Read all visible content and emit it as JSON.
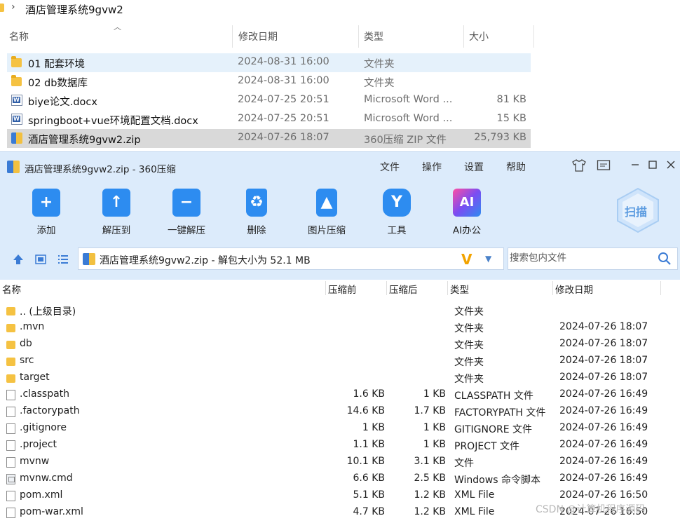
{
  "explorer": {
    "breadcrumb": "酒店管理系统9gvw2",
    "headers": {
      "name": "名称",
      "date": "修改日期",
      "type": "类型",
      "size": "大小"
    },
    "rows": [
      {
        "name": "01 配套环境",
        "date": "2024-08-31 16:00",
        "type": "文件夹",
        "size": "",
        "icon": "folder-icon",
        "state": "hover"
      },
      {
        "name": "02 db数据库",
        "date": "2024-08-31 16:00",
        "type": "文件夹",
        "size": "",
        "icon": "folder-icon",
        "state": ""
      },
      {
        "name": "biye论文.docx",
        "date": "2024-07-25 20:51",
        "type": "Microsoft Word ...",
        "size": "81 KB",
        "icon": "word-doc-icon",
        "state": ""
      },
      {
        "name": "springboot+vue环境配置文档.docx",
        "date": "2024-07-25 20:51",
        "type": "Microsoft Word ...",
        "size": "15 KB",
        "icon": "word-doc-icon",
        "state": ""
      },
      {
        "name": "酒店管理系统9gvw2.zip",
        "date": "2024-07-26 18:07",
        "type": "360压缩 ZIP 文件",
        "size": "25,793 KB",
        "icon": "zip-archive-icon",
        "state": "selected"
      }
    ]
  },
  "window": {
    "title": "酒店管理系统9gvw2.zip - 360压缩",
    "menu": [
      "文件",
      "操作",
      "设置",
      "帮助"
    ],
    "tools": [
      {
        "label": "添加",
        "icon": "add-folder-icon",
        "color": "#2d8cf0",
        "glyph": "+"
      },
      {
        "label": "解压到",
        "icon": "extract-to-icon",
        "color": "#2d8cf0",
        "glyph": "↑"
      },
      {
        "label": "一键解压",
        "icon": "one-click-extract-icon",
        "color": "#2d8cf0",
        "glyph": "−"
      },
      {
        "label": "删除",
        "icon": "recycle-bin-icon",
        "color": "#2d8cf0",
        "glyph": "♻"
      },
      {
        "label": "图片压缩",
        "icon": "image-compress-icon",
        "color": "#2d8cf0",
        "glyph": "▲"
      },
      {
        "label": "工具",
        "icon": "tools-icon",
        "color": "#2d8cf0",
        "glyph": "Y"
      },
      {
        "label": "AI办公",
        "icon": "ai-office-icon",
        "color": "#7b4df2",
        "glyph": "AI"
      }
    ],
    "scan_label": "扫描",
    "path": "酒店管理系统9gvw2.zip - 解包大小为 52.1 MB",
    "search_placeholder": "搜索包内文件",
    "columns": {
      "name": "名称",
      "compressed_before": "压缩前",
      "compressed_after": "压缩后",
      "type": "类型",
      "modified": "修改日期"
    },
    "files": [
      {
        "name": ".. (上级目录)",
        "before": "",
        "after": "",
        "type": "文件夹",
        "date": "",
        "icon": "folder"
      },
      {
        "name": ".mvn",
        "before": "",
        "after": "",
        "type": "文件夹",
        "date": "2024-07-26 18:07",
        "icon": "folder"
      },
      {
        "name": "db",
        "before": "",
        "after": "",
        "type": "文件夹",
        "date": "2024-07-26 18:07",
        "icon": "folder"
      },
      {
        "name": "src",
        "before": "",
        "after": "",
        "type": "文件夹",
        "date": "2024-07-26 18:07",
        "icon": "folder"
      },
      {
        "name": "target",
        "before": "",
        "after": "",
        "type": "文件夹",
        "date": "2024-07-26 18:07",
        "icon": "folder"
      },
      {
        "name": ".classpath",
        "before": "1.6 KB",
        "after": "1 KB",
        "type": "CLASSPATH 文件",
        "date": "2024-07-26 16:49",
        "icon": "file"
      },
      {
        "name": ".factorypath",
        "before": "14.6 KB",
        "after": "1.7 KB",
        "type": "FACTORYPATH 文件",
        "date": "2024-07-26 16:49",
        "icon": "file"
      },
      {
        "name": ".gitignore",
        "before": "1 KB",
        "after": "1 KB",
        "type": "GITIGNORE 文件",
        "date": "2024-07-26 16:49",
        "icon": "file"
      },
      {
        "name": ".project",
        "before": "1.1 KB",
        "after": "1 KB",
        "type": "PROJECT 文件",
        "date": "2024-07-26 16:49",
        "icon": "file"
      },
      {
        "name": "mvnw",
        "before": "10.1 KB",
        "after": "3.1 KB",
        "type": "文件",
        "date": "2024-07-26 16:49",
        "icon": "file"
      },
      {
        "name": "mvnw.cmd",
        "before": "6.6 KB",
        "after": "2.5 KB",
        "type": "Windows 命令脚本",
        "date": "2024-07-26 16:49",
        "icon": "cmd"
      },
      {
        "name": "pom.xml",
        "before": "5.1 KB",
        "after": "1.2 KB",
        "type": "XML File",
        "date": "2024-07-26 16:50",
        "icon": "file"
      },
      {
        "name": "pom-war.xml",
        "before": "4.7 KB",
        "after": "1.2 KB",
        "type": "XML File",
        "date": "2024-07-26 16:50",
        "icon": "file"
      }
    ]
  },
  "watermark": "CSDN @计算机程序源码"
}
